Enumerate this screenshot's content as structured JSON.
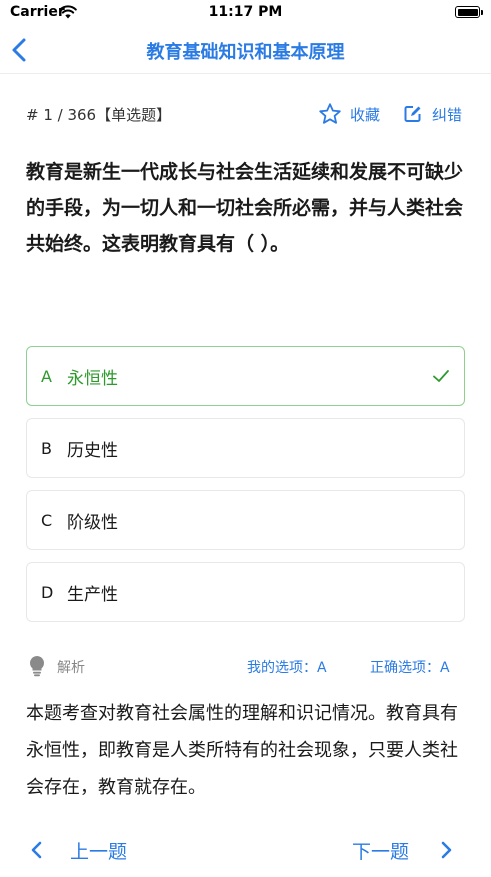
{
  "status_bar": {
    "carrier": "Carrier",
    "time": "11:17 PM"
  },
  "nav": {
    "title": "教育基础知识和基本原理"
  },
  "question": {
    "meta": "# 1 / 366【单选题】",
    "favorite_label": "收藏",
    "correct_error_label": "纠错",
    "text": "教育是新生一代成长与社会生活延续和发展不可缺少的手段，为一切人和一切社会所必需，并与人类社会共始终。这表明教育具有（ ）。"
  },
  "options": [
    {
      "letter": "A",
      "text": "永恒性"
    },
    {
      "letter": "B",
      "text": "历史性"
    },
    {
      "letter": "C",
      "text": "阶级性"
    },
    {
      "letter": "D",
      "text": "生产性"
    }
  ],
  "analysis": {
    "label": "解析",
    "my_choice": "我的选项：A",
    "correct_choice": "正确选项：A",
    "text": "本题考查对教育社会属性的理解和识记情况。教育具有永恒性，即教育是人类所特有的社会现象，只要人类社会存在，教育就存在。"
  },
  "footer": {
    "prev_label": "上一题",
    "next_label": "下一题"
  },
  "colors": {
    "accent": "#2b7be4",
    "correct": "#2e9a2e",
    "correct_border": "#8fcf8f"
  },
  "icons": {
    "back": "chevron-left-icon",
    "favorite": "star-outline-icon",
    "correct_error": "edit-icon",
    "selected": "checkmark-icon",
    "analysis": "lightbulb-icon",
    "prev": "chevron-left-icon",
    "next": "chevron-right-icon"
  }
}
